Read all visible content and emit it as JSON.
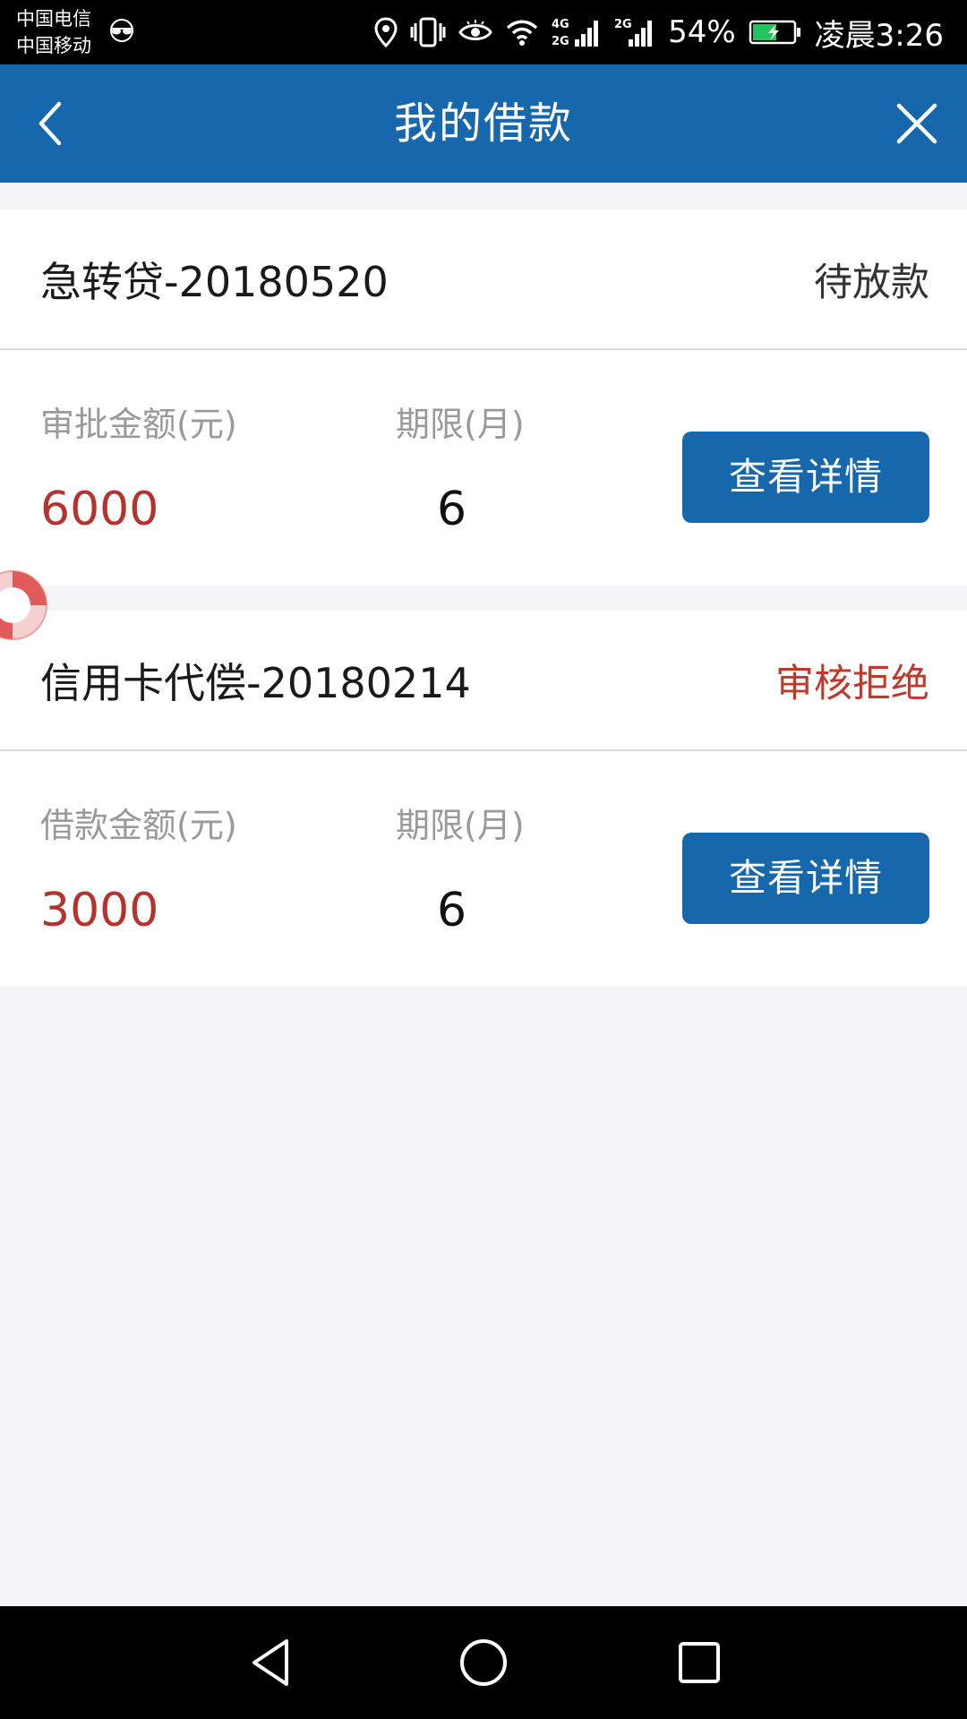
{
  "status_bar": {
    "carrier_1": "中国电信",
    "carrier_2": "中国移动",
    "network_4g": "4G",
    "network_2g_a": "2G",
    "network_2g_b": "2G",
    "battery": "54%",
    "time": "凌晨3:26"
  },
  "nav": {
    "title": "我的借款"
  },
  "loans": [
    {
      "name": "急转贷-20180520",
      "status": "待放款",
      "amount_label": "审批金额(元)",
      "amount": "6000",
      "term_label": "期限(月)",
      "term": "6",
      "button": "查看详情"
    },
    {
      "name": "信用卡代偿-20180214",
      "status": "审核拒绝",
      "amount_label": "借款金额(元)",
      "amount": "3000",
      "term_label": "期限(月)",
      "term": "6",
      "button": "查看详情"
    }
  ],
  "colors": {
    "primary": "#1767ad",
    "amount_red": "#b5332f",
    "rejected_red": "#c0392b",
    "background": "#f4f5f7"
  }
}
